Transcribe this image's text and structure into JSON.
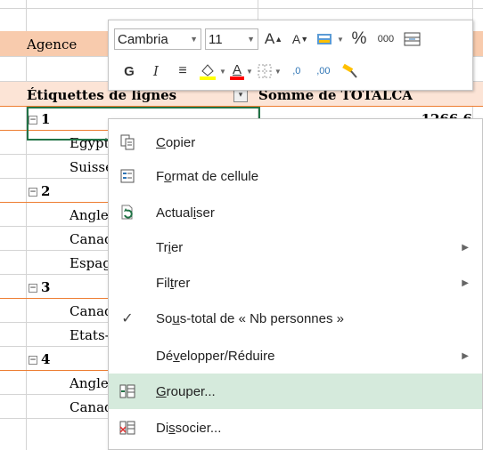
{
  "sheet": {
    "filter_label": "Agence",
    "row_labels_header": "Étiquettes de lignes",
    "sum_header": "Somme de TOTALCA",
    "rows": [
      {
        "type": "group",
        "label": "1",
        "value": "1266.6"
      },
      {
        "type": "item",
        "label": "Egypte"
      },
      {
        "type": "item",
        "label": "Suisse"
      },
      {
        "type": "group",
        "label": "2"
      },
      {
        "type": "item",
        "label": "Angleterre"
      },
      {
        "type": "item",
        "label": "Canada"
      },
      {
        "type": "item",
        "label": "Espagne"
      },
      {
        "type": "group",
        "label": "3"
      },
      {
        "type": "item",
        "label": "Canada"
      },
      {
        "type": "item",
        "label": "Etats-Unis"
      },
      {
        "type": "group",
        "label": "4"
      },
      {
        "type": "item",
        "label": "Angleterre"
      },
      {
        "type": "item",
        "label": "Canada"
      }
    ]
  },
  "minibar": {
    "font_name": "Cambria",
    "font_size": "11",
    "grow_font": "A",
    "shrink_font": "A",
    "percent": "%",
    "thousands": "000",
    "bold": "G",
    "italic": "I",
    "font_color_letter": "A",
    "inc_decimal": ",0",
    "dec_decimal": ",00",
    "colors": {
      "highlight": "#ffff00",
      "font": "#ff0000"
    }
  },
  "menu": {
    "items": [
      {
        "label": "Copier",
        "icon": "copy-icon",
        "underline": "C"
      },
      {
        "label": "Format de cellule",
        "icon": "format-cells-icon",
        "underline": "o"
      },
      {
        "label": "Actualiser",
        "icon": "refresh-icon",
        "underline": "i"
      },
      {
        "label": "Trier",
        "icon": "",
        "underline": "i",
        "submenu": true
      },
      {
        "label": "Filtrer",
        "icon": "",
        "underline": "t",
        "submenu": true
      },
      {
        "label": "Sous-total de « Nb personnes »",
        "icon": "checkmark-icon",
        "underline": "u"
      },
      {
        "label": "Développer/Réduire",
        "icon": "",
        "underline": "v",
        "submenu": true
      },
      {
        "label": "Grouper...",
        "icon": "group-icon",
        "underline": "G",
        "hovered": true
      },
      {
        "label": "Dissocier...",
        "icon": "ungroup-icon",
        "underline": "s"
      }
    ]
  }
}
